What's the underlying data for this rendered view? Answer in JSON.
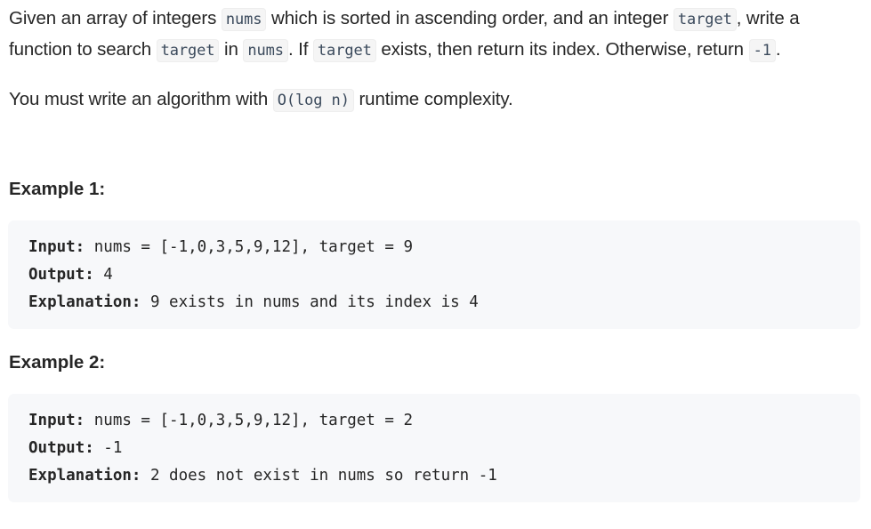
{
  "description": {
    "p1_seg1": "Given an array of integers ",
    "p1_code_nums": "nums",
    "p1_seg2": " which is sorted in ascending order, and an integer ",
    "p1_code_target": "target",
    "p1_seg3": ", write a function to search ",
    "p1_code_target2": "target",
    "p1_seg4": " in ",
    "p1_code_nums2": "nums",
    "p1_seg5": ". If ",
    "p1_code_target3": "target",
    "p1_seg6": " exists, then return its index. Otherwise, return ",
    "p1_code_neg1": "-1",
    "p1_seg7": ".",
    "p2_seg1": "You must write an algorithm with ",
    "p2_code": "O(log n)",
    "p2_seg2": " runtime complexity."
  },
  "examples": [
    {
      "heading": "Example 1:",
      "input_label": "Input:",
      "input_value": " nums = [-1,0,3,5,9,12], target = 9",
      "output_label": "Output:",
      "output_value": " 4",
      "explanation_label": "Explanation:",
      "explanation_value": " 9 exists in nums and its index is 4"
    },
    {
      "heading": "Example 2:",
      "input_label": "Input:",
      "input_value": " nums = [-1,0,3,5,9,12], target = 2",
      "output_label": "Output:",
      "output_value": " -1",
      "explanation_label": "Explanation:",
      "explanation_value": " 2 does not exist in nums so return -1"
    }
  ]
}
